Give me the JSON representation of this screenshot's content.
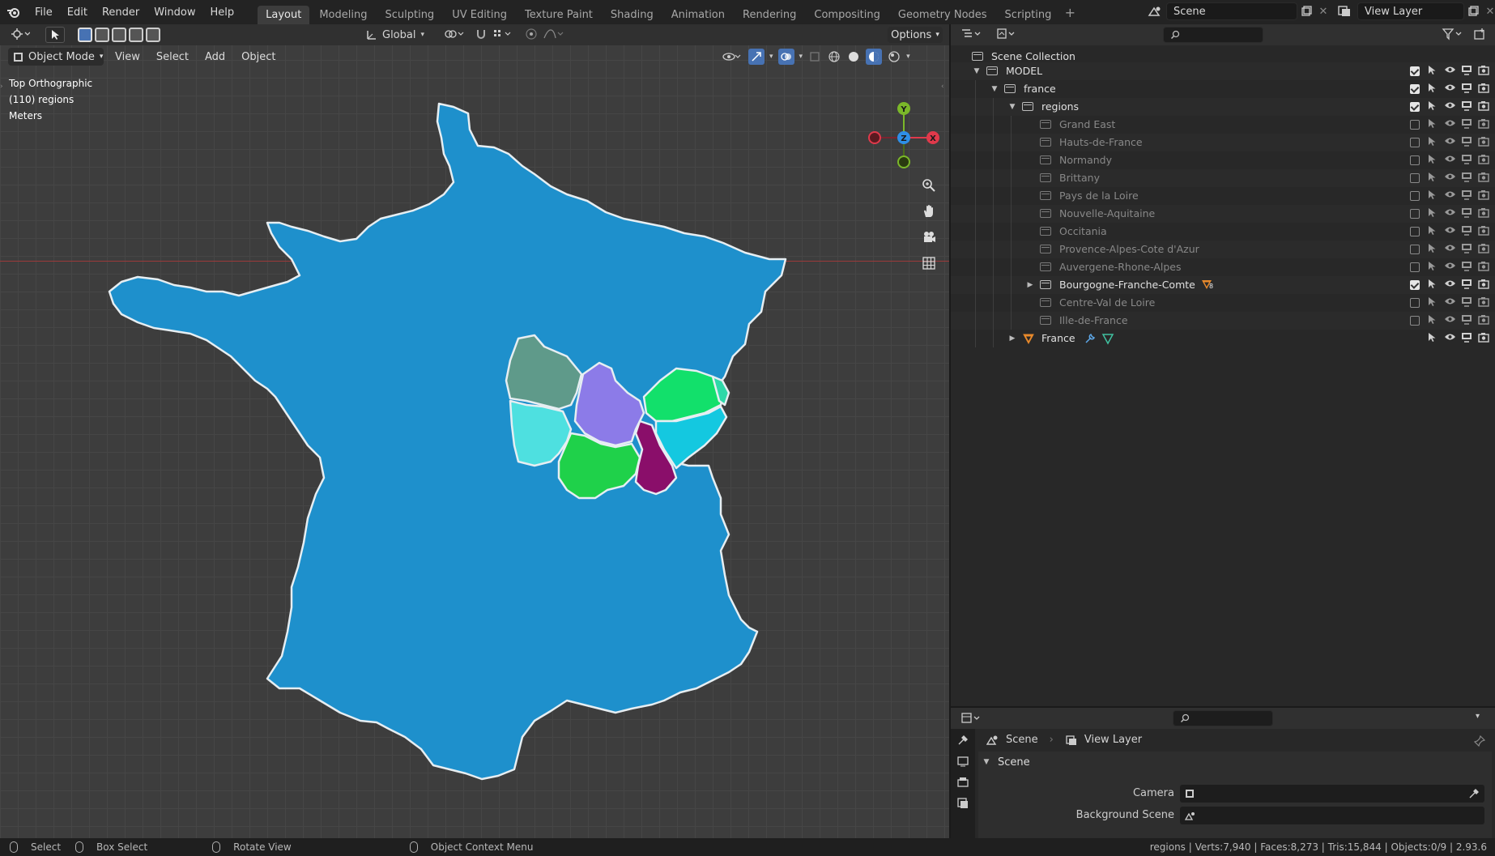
{
  "topbar": {
    "menu": [
      "File",
      "Edit",
      "Render",
      "Window",
      "Help"
    ],
    "workspaces": [
      "Layout",
      "Modeling",
      "Sculpting",
      "UV Editing",
      "Texture Paint",
      "Shading",
      "Animation",
      "Rendering",
      "Compositing",
      "Geometry Nodes",
      "Scripting"
    ],
    "active_workspace": "Layout",
    "add_tab_icon": "plus-icon",
    "scene_name": "Scene",
    "view_layer_name": "View Layer"
  },
  "viewport_header": {
    "transform_orientation": "Global",
    "options_label": "Options",
    "mode": "Object Mode",
    "menus": [
      "View",
      "Select",
      "Add",
      "Object"
    ]
  },
  "viewport_overlay": {
    "view_name": "Top Orthographic",
    "collection_info": "(110) regions",
    "units": "Meters"
  },
  "gizmo": {
    "y_label": "Y",
    "z_label": "Z",
    "x_label": "X",
    "colors": {
      "x": "#e0394b",
      "y": "#7bb829",
      "z": "#2e8fe8"
    }
  },
  "map": {
    "france_color": "#1e90cc",
    "highlight_region": "Bourgogne-Franche-Comte",
    "subregion_colors": [
      "#5f9a8a",
      "#8c7be8",
      "#12e06b",
      "#4ee0e0",
      "#1fd14a",
      "#8a0e6a",
      "#14c8e0"
    ]
  },
  "outliner": {
    "root": "Scene Collection",
    "rows": [
      {
        "label": "MODEL",
        "depth": 1,
        "expanded": true,
        "checked": true,
        "type": "collection"
      },
      {
        "label": "france",
        "depth": 2,
        "expanded": true,
        "checked": true,
        "type": "collection"
      },
      {
        "label": "regions",
        "depth": 3,
        "expanded": true,
        "checked": true,
        "type": "collection"
      },
      {
        "label": "Grand East",
        "depth": 4,
        "checked": false,
        "type": "collection",
        "dim": true
      },
      {
        "label": "Hauts-de-France",
        "depth": 4,
        "checked": false,
        "type": "collection",
        "dim": true
      },
      {
        "label": "Normandy",
        "depth": 4,
        "checked": false,
        "type": "collection",
        "dim": true
      },
      {
        "label": "Brittany",
        "depth": 4,
        "checked": false,
        "type": "collection",
        "dim": true
      },
      {
        "label": "Pays de la Loire",
        "depth": 4,
        "checked": false,
        "type": "collection",
        "dim": true
      },
      {
        "label": "Nouvelle-Aquitaine",
        "depth": 4,
        "checked": false,
        "type": "collection",
        "dim": true
      },
      {
        "label": "Occitania",
        "depth": 4,
        "checked": false,
        "type": "collection",
        "dim": true
      },
      {
        "label": "Provence-Alpes-Cote d'Azur",
        "depth": 4,
        "checked": false,
        "type": "collection",
        "dim": true
      },
      {
        "label": "Auvergene-Rhone-Alpes",
        "depth": 4,
        "checked": false,
        "type": "collection",
        "dim": true
      },
      {
        "label": "Bourgogne-Franche-Comte",
        "depth": 4,
        "checked": true,
        "type": "collection",
        "dim": false,
        "collapsed": true,
        "badge": "8"
      },
      {
        "label": "Centre-Val de Loire",
        "depth": 4,
        "checked": false,
        "type": "collection",
        "dim": true
      },
      {
        "label": "Ille-de-France",
        "depth": 4,
        "checked": false,
        "type": "collection",
        "dim": true
      },
      {
        "label": "France",
        "depth": 3,
        "type": "mesh",
        "collapsed": true
      }
    ]
  },
  "properties": {
    "breadcrumb_scene": "Scene",
    "breadcrumb_view_layer": "View Layer",
    "panel_title": "Scene",
    "camera_label": "Camera",
    "background_scene_label": "Background Scene"
  },
  "statusbar": {
    "select": "Select",
    "box_select": "Box Select",
    "rotate_view": "Rotate View",
    "context_menu": "Object Context Menu",
    "stats": "regions | Verts:7,940 | Faces:8,273 | Tris:15,844 | Objects:0/9 | 2.93.6"
  }
}
